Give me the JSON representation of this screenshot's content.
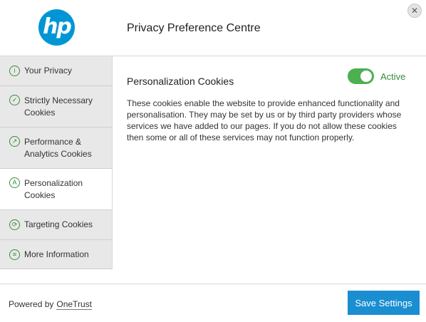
{
  "header": {
    "logo_text": "hp",
    "title": "Privacy Preference Centre",
    "close_symbol": "✕"
  },
  "sidebar": {
    "items": [
      {
        "label": "Your Privacy",
        "icon": "info-icon",
        "glyph": "i"
      },
      {
        "label": "Strictly Necessary Cookies",
        "icon": "check-icon",
        "glyph": "✓"
      },
      {
        "label": "Performance & Analytics Cookies",
        "icon": "chart-icon",
        "glyph": "↗"
      },
      {
        "label": "Personalization Cookies",
        "icon": "personalize-icon",
        "glyph": "A"
      },
      {
        "label": "Targeting Cookies",
        "icon": "refresh-icon",
        "glyph": "⟳"
      },
      {
        "label": "More Information",
        "icon": "document-icon",
        "glyph": "≡"
      }
    ],
    "active_index": 3
  },
  "content": {
    "section_title": "Personalization Cookies",
    "toggle_state": "Active",
    "toggle_on": true,
    "description": "These cookies enable the website to provide enhanced functionality and personalisation. They may be set by us or by third party providers whose services we have added to our pages. If you do not allow these cookies then some or all of these services may not function properly."
  },
  "footer": {
    "powered_by": "Powered by",
    "brand": "OneTrust",
    "save_label": "Save Settings"
  },
  "colors": {
    "accent_blue": "#1a8ed1",
    "hp_blue": "#0096d6",
    "toggle_green": "#4caf50"
  }
}
